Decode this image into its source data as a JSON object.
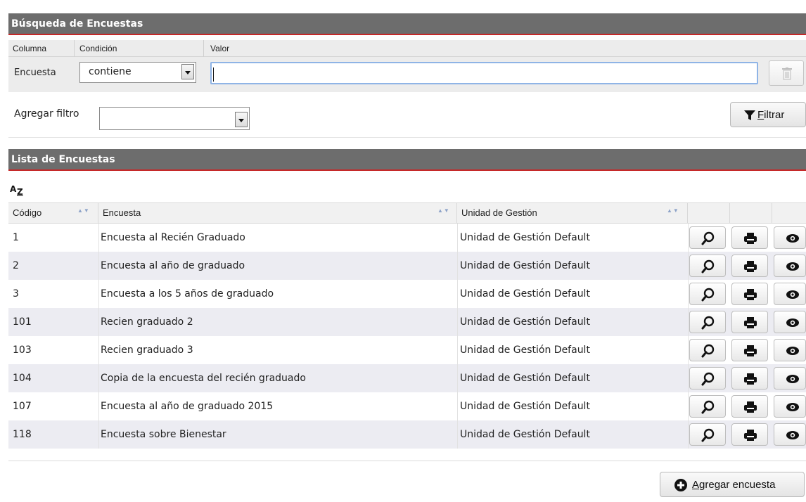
{
  "search": {
    "title": "Búsqueda de Encuestas",
    "columns": {
      "column": "Columna",
      "condition": "Condición",
      "value": "Valor"
    },
    "filter": {
      "column_name": "Encuesta",
      "condition": "contiene",
      "value": ""
    },
    "add_filter_label": "Agregar filtro",
    "add_filter_value": "",
    "filter_button": "Filtrar"
  },
  "list": {
    "title": "Lista de Encuestas",
    "sort_icon": "AZ",
    "headers": {
      "code": "Código",
      "survey": "Encuesta",
      "unit": "Unidad de Gestión"
    },
    "rows": [
      {
        "code": "1",
        "survey": "Encuesta al Recién Graduado",
        "unit": "Unidad de Gestión Default"
      },
      {
        "code": "2",
        "survey": "Encuesta al año de graduado",
        "unit": "Unidad de Gestión Default"
      },
      {
        "code": "3",
        "survey": "Encuesta a los 5 años de graduado",
        "unit": "Unidad de Gestión Default"
      },
      {
        "code": "101",
        "survey": "Recien graduado 2",
        "unit": "Unidad de Gestión Default"
      },
      {
        "code": "103",
        "survey": "Recien graduado 3",
        "unit": "Unidad de Gestión Default"
      },
      {
        "code": "104",
        "survey": "Copia de la encuesta del recién graduado",
        "unit": "Unidad de Gestión Default"
      },
      {
        "code": "107",
        "survey": "Encuesta al año de graduado 2015",
        "unit": "Unidad de Gestión Default"
      },
      {
        "code": "118",
        "survey": "Encuesta sobre Bienestar",
        "unit": "Unidad de Gestión Default"
      }
    ],
    "row_actions": [
      "magnifier-icon",
      "printer-icon",
      "eye-icon"
    ],
    "add_button": "Agregar encuesta"
  },
  "colors": {
    "header_bg": "#6d6d6d",
    "header_underline": "#c62828",
    "alt_row": "#ececf2"
  }
}
